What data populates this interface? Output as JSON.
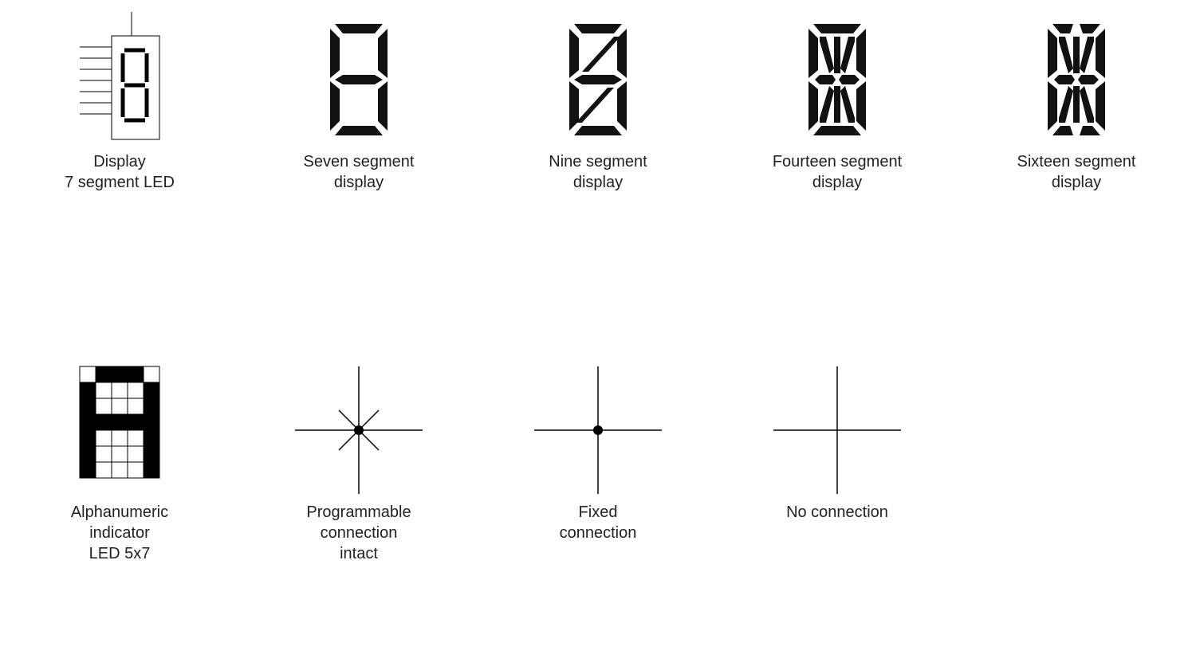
{
  "symbols": {
    "seven_seg_led": {
      "label": "Display\n7 segment LED"
    },
    "seven_seg": {
      "label": "Seven segment\ndisplay"
    },
    "nine_seg": {
      "label": "Nine segment\ndisplay"
    },
    "fourteen_seg": {
      "label": "Fourteen segment\ndisplay"
    },
    "sixteen_seg": {
      "label": "Sixteen segment\ndisplay"
    },
    "alpha_5x7": {
      "label": "Alphanumeric\nindicator\nLED 5x7"
    },
    "prog_conn": {
      "label": "Programmable\nconnection\nintact"
    },
    "fixed_conn": {
      "label": "Fixed\nconnection"
    },
    "no_conn": {
      "label": "No connection"
    }
  }
}
